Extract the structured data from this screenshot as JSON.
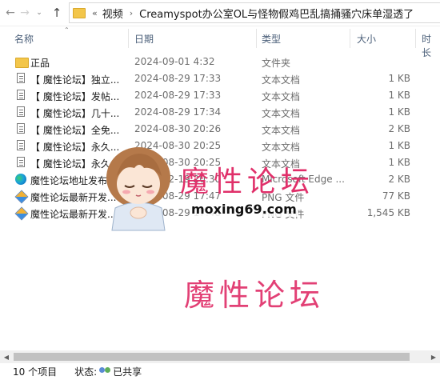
{
  "address": {
    "overflow_chevron": "«",
    "segments": [
      "视频",
      "Creamyspot办公室OL与怪物假鸡巴乱搞捅骚穴床单湿透了"
    ]
  },
  "columns": {
    "name": "名称",
    "date": "日期",
    "type": "类型",
    "size": "大小",
    "tags": "时长"
  },
  "files": [
    {
      "icon": "folder-icon",
      "name": "正品",
      "date": "2024-09-01 4:32",
      "type": "文件夹",
      "size": ""
    },
    {
      "icon": "text-file-icon",
      "name": "【 魔性论坛】独立...",
      "date": "2024-08-29 17:33",
      "type": "文本文档",
      "size": "1 KB"
    },
    {
      "icon": "text-file-icon",
      "name": "【 魔性论坛】发帖...",
      "date": "2024-08-29 17:33",
      "type": "文本文档",
      "size": "1 KB"
    },
    {
      "icon": "text-file-icon",
      "name": "【 魔性论坛】几十...",
      "date": "2024-08-29 17:34",
      "type": "文本文档",
      "size": "1 KB"
    },
    {
      "icon": "text-file-icon",
      "name": "【 魔性论坛】全免...",
      "date": "2024-08-30 20:26",
      "type": "文本文档",
      "size": "2 KB"
    },
    {
      "icon": "text-file-icon",
      "name": "【 魔性论坛】永久...",
      "date": "2024-08-30 20:25",
      "type": "文本文档",
      "size": "1 KB"
    },
    {
      "icon": "text-file-icon",
      "name": "【 魔性论坛】永久...",
      "date": "2024-08-30 20:25",
      "type": "文本文档",
      "size": "1 KB"
    },
    {
      "icon": "edge-icon",
      "name": "魔性论坛地址发布...",
      "date": "2024-02-19 20:30",
      "type": "Microsoft Edge ...",
      "size": "2 KB"
    },
    {
      "icon": "png-file-icon",
      "name": "魔性论坛最新开发...",
      "date": "2024-08-29 17:47",
      "type": "PNG 文件",
      "size": "77 KB"
    },
    {
      "icon": "png-file-icon",
      "name": "魔性论坛最新开发...",
      "date": "2024-08-29 17:48",
      "type": "PNG 文件",
      "size": "1,545 KB"
    }
  ],
  "watermark": {
    "top_text": "魔性论坛",
    "url": "moxing69.com",
    "bottom_text": "魔性论坛"
  },
  "status": {
    "count": "10 个项目",
    "state_label": "状态:",
    "state_value": "已共享"
  }
}
